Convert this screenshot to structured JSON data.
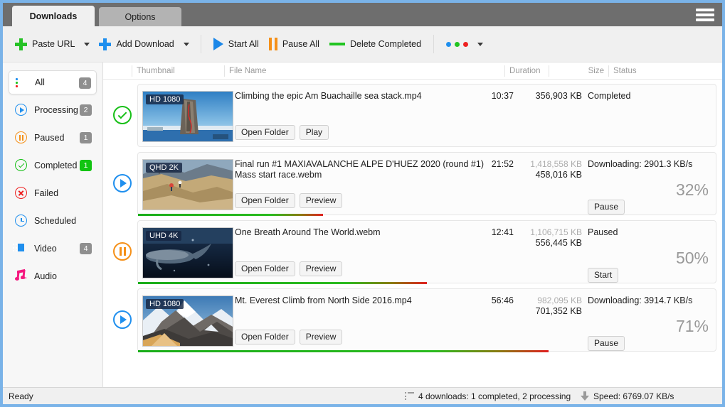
{
  "window": {
    "tabs": [
      {
        "label": "Downloads",
        "active": true
      },
      {
        "label": "Options",
        "active": false
      }
    ],
    "menu_icon": "hamburger-icon"
  },
  "toolbar": {
    "paste_url": "Paste URL",
    "add_download": "Add Download",
    "start_all": "Start All",
    "pause_all": "Pause All",
    "delete_completed": "Delete Completed",
    "more_options": "more-options-icon",
    "accent_green": "#26c226",
    "accent_blue": "#1f8fee",
    "accent_orange": "#f59018",
    "accent_red": "#ee2121"
  },
  "sidebar": {
    "items": [
      {
        "label": "All",
        "icon": "list-icon",
        "badge": "4",
        "selected": true,
        "badge_style": "gray"
      },
      {
        "label": "Processing",
        "icon": "play-circle-icon",
        "badge": "2",
        "selected": false,
        "badge_style": "gray"
      },
      {
        "label": "Paused",
        "icon": "pause-circle-icon",
        "badge": "1",
        "selected": false,
        "badge_style": "gray"
      },
      {
        "label": "Completed",
        "icon": "check-circle-icon",
        "badge": "1",
        "selected": false,
        "badge_style": "green"
      },
      {
        "label": "Failed",
        "icon": "error-circle-icon",
        "badge": "",
        "selected": false,
        "badge_style": "none"
      },
      {
        "label": "Scheduled",
        "icon": "clock-icon",
        "badge": "",
        "selected": false,
        "badge_style": "none"
      },
      {
        "label": "Video",
        "icon": "film-icon",
        "badge": "4",
        "selected": false,
        "badge_style": "gray"
      },
      {
        "label": "Audio",
        "icon": "music-note-icon",
        "badge": "",
        "selected": false,
        "badge_style": "none"
      }
    ]
  },
  "columns": {
    "thumbnail": "Thumbnail",
    "file_name": "File Name",
    "duration": "Duration",
    "size": "Size",
    "status": "Status"
  },
  "downloads": [
    {
      "state_icon": "check-circle-icon",
      "quality": "HD 1080",
      "file_name": "Climbing the epic Am Buachaille sea stack.mp4",
      "duration": "10:37",
      "size_total": "",
      "size_done": "356,903 KB",
      "status": "Completed",
      "percent": "",
      "progress": 100,
      "buttons": [
        "Open Folder",
        "Play"
      ],
      "action_button": "",
      "show_progressbar": false
    },
    {
      "state_icon": "play-circle-icon",
      "quality": "QHD 2K",
      "file_name": "Final run #1  MAXIAVALANCHE ALPE D'HUEZ 2020 (round #1) Mass start race.webm",
      "duration": "21:52",
      "size_total": "1,418,558 KB",
      "size_done": "458,016 KB",
      "status": "Downloading: 2901.3 KB/s",
      "percent": "32%",
      "progress": 32,
      "buttons": [
        "Open Folder",
        "Preview"
      ],
      "action_button": "Pause",
      "show_progressbar": true
    },
    {
      "state_icon": "pause-circle-icon",
      "quality": "UHD 4K",
      "file_name": "One Breath Around The World.webm",
      "duration": "12:41",
      "size_total": "1,106,715 KB",
      "size_done": "556,445 KB",
      "status": "Paused",
      "percent": "50%",
      "progress": 50,
      "buttons": [
        "Open Folder",
        "Preview"
      ],
      "action_button": "Start",
      "show_progressbar": true
    },
    {
      "state_icon": "play-circle-icon",
      "quality": "HD 1080",
      "file_name": "Mt. Everest Climb from North Side 2016.mp4",
      "duration": "56:46",
      "size_total": "982,095 KB",
      "size_done": "701,352 KB",
      "status": "Downloading: 3914.7 KB/s",
      "percent": "71%",
      "progress": 71,
      "buttons": [
        "Open Folder",
        "Preview"
      ],
      "action_button": "Pause",
      "show_progressbar": true
    }
  ],
  "statusbar": {
    "ready": "Ready",
    "summary": "4 downloads: 1 completed, 2 processing",
    "speed": "Speed: 6769.07 KB/s"
  }
}
